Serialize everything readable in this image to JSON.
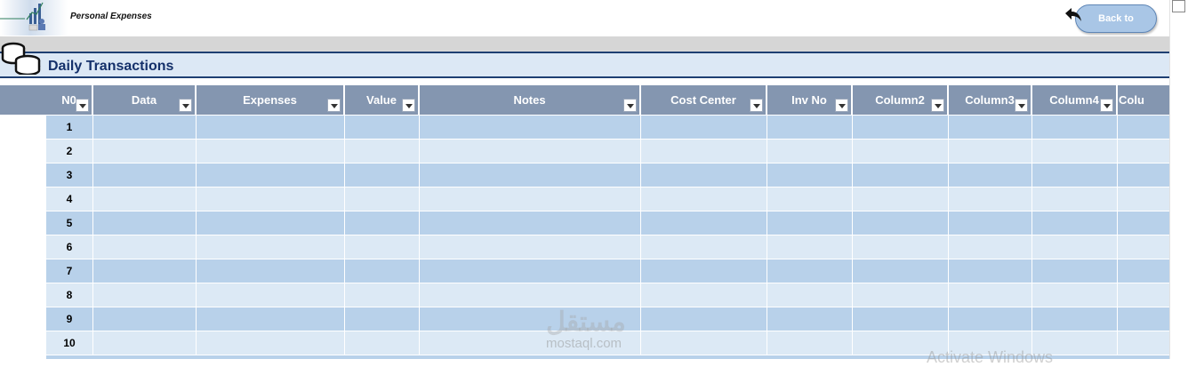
{
  "app": {
    "title": "Personal Expenses",
    "back_label": "Back to"
  },
  "section": {
    "title": "Daily Transactions"
  },
  "table": {
    "columns": [
      {
        "label": "N0"
      },
      {
        "label": "Data"
      },
      {
        "label": "Expenses"
      },
      {
        "label": "Value"
      },
      {
        "label": "Notes"
      },
      {
        "label": "Cost Center"
      },
      {
        "label": "Inv No"
      },
      {
        "label": "Column2"
      },
      {
        "label": "Column3"
      },
      {
        "label": "Column4"
      },
      {
        "label": "Colu"
      }
    ],
    "rows": [
      "1",
      "2",
      "3",
      "4",
      "5",
      "6",
      "7",
      "8",
      "9",
      "10"
    ]
  },
  "watermarks": {
    "arabic": "مستقل",
    "site": "mostaql.com",
    "os": "Activate Windows"
  },
  "colors": {
    "header_bg": "#8496b0",
    "row_dark": "#b8d1ea",
    "row_light": "#dce9f5",
    "section_bg": "#dce8f5",
    "title_color": "#14306a"
  },
  "icons": {
    "logo": "chart-person-logo-icon",
    "back": "back-arrow-icon",
    "section": "coins-icon"
  }
}
